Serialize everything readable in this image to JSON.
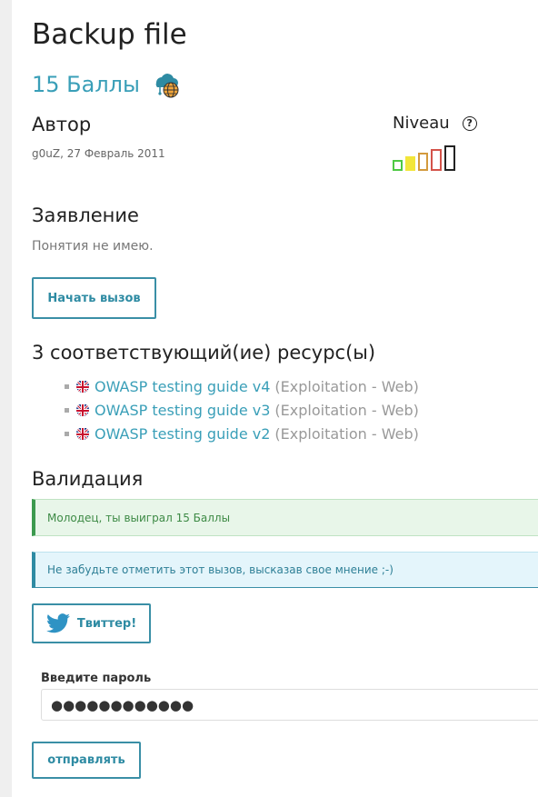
{
  "challenge": {
    "title": "Backup file",
    "points_label": "15 Баллы"
  },
  "author": {
    "heading": "Автор",
    "name": "g0uZ,",
    "date": "27 Февраль 2011"
  },
  "level": {
    "heading": "Niveau",
    "help_symbol": "?",
    "bar_colors": [
      "#4ec944",
      "#f2e63a",
      "#d39a3e",
      "#d4534a",
      "#222222"
    ],
    "current_level": 5
  },
  "statement": {
    "heading": "Заявление",
    "text": "Понятия не имею.",
    "start_button": "Начать вызов"
  },
  "resources": {
    "heading": "3 соответствующий(ие) ресурс(ы)",
    "items": [
      {
        "title": "OWASP testing guide v4",
        "category": "(Exploitation - Web)"
      },
      {
        "title": "OWASP testing guide v3",
        "category": "(Exploitation - Web)"
      },
      {
        "title": "OWASP testing guide v2",
        "category": "(Exploitation - Web)"
      }
    ]
  },
  "validation": {
    "heading": "Валидация",
    "success_message": "Молодец, ты выиграл 15 Баллы",
    "info_message": "Не забудьте отметить этот вызов, высказав свое мнение ;-)",
    "twitter_button": "Твиттер!",
    "password_label": "Введите пароль",
    "password_value": "●●●●●●●●●●●●",
    "submit_button": "отправлять"
  },
  "colors": {
    "accent": "#3a9fb8",
    "success": "#3c9a4f",
    "info": "#2e8ba3"
  },
  "icons": {
    "points": "cloud-globe-icon",
    "help": "help-circle-icon",
    "flag": "uk-flag-icon",
    "twitter": "twitter-bird-icon"
  }
}
